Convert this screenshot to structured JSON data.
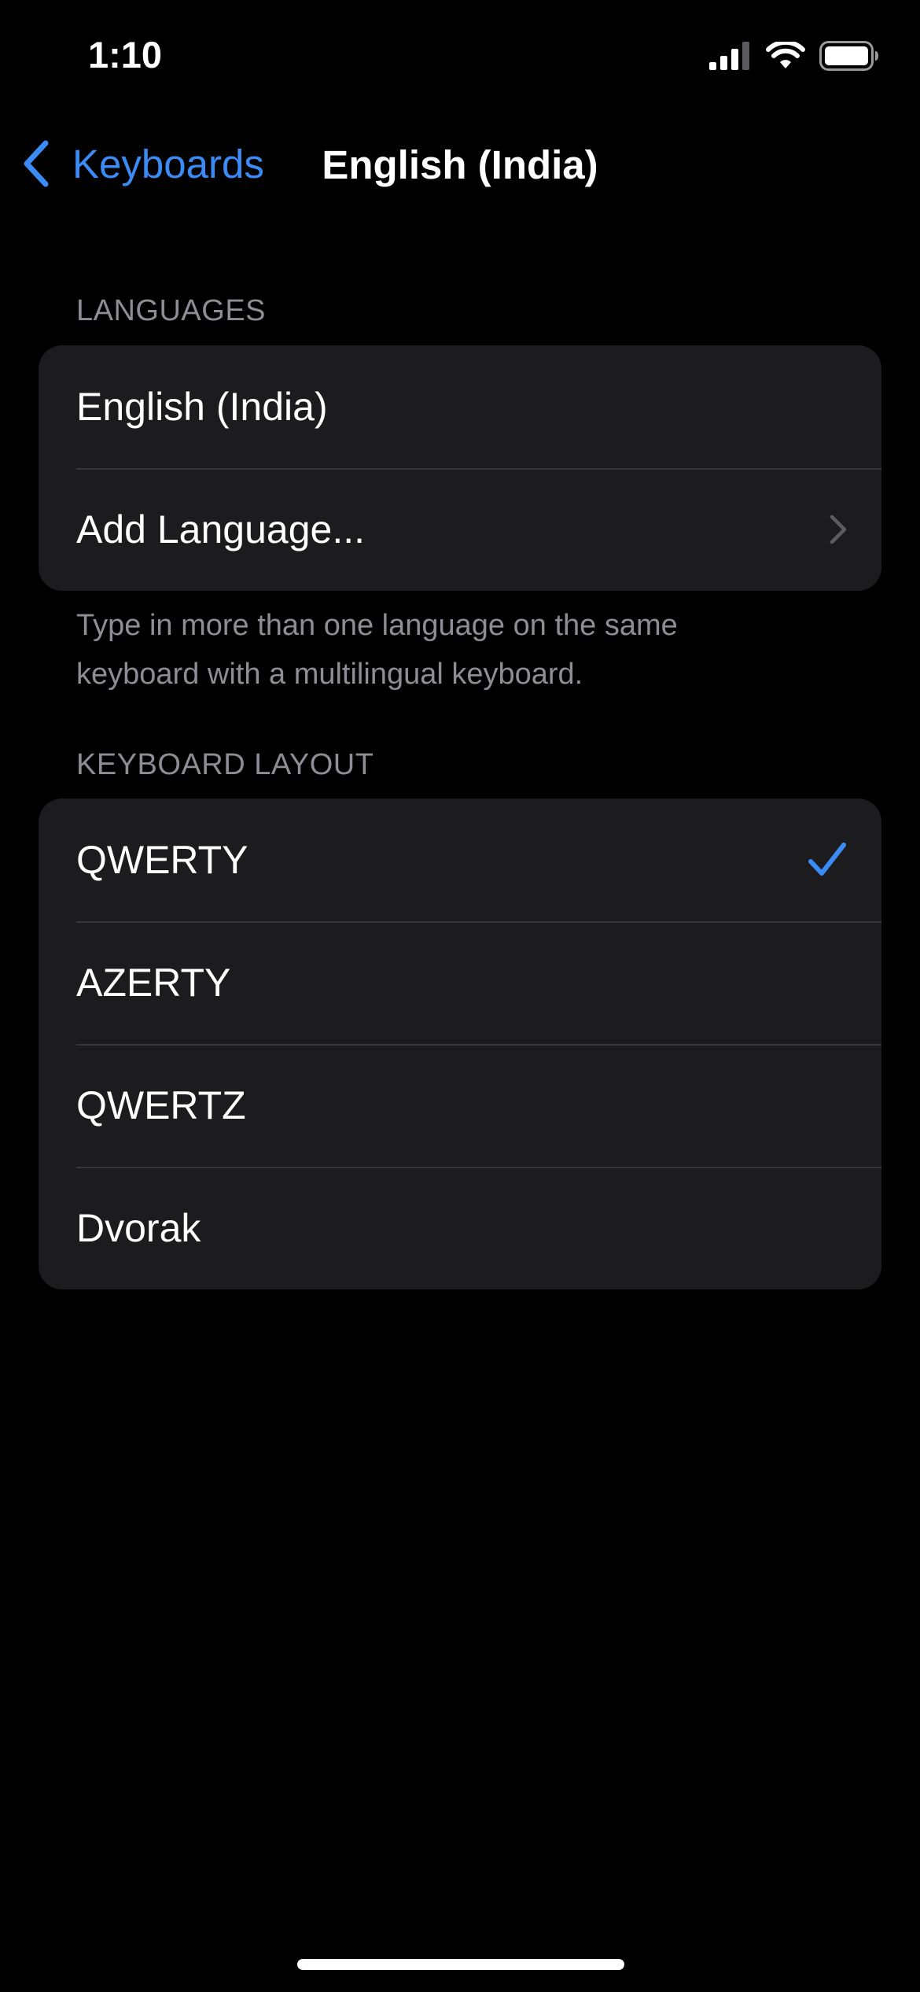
{
  "status_bar": {
    "time": "1:10"
  },
  "nav": {
    "back_label": "Keyboards",
    "title": "English (India)"
  },
  "languages_section": {
    "header": "LANGUAGES",
    "items": [
      {
        "label": "English (India)"
      },
      {
        "label": "Add Language..."
      }
    ],
    "footer": "Type in more than one language on the same keyboard with a multilingual keyboard."
  },
  "layout_section": {
    "header": "KEYBOARD LAYOUT",
    "items": [
      {
        "label": "QWERTY",
        "selected": true
      },
      {
        "label": "AZERTY",
        "selected": false
      },
      {
        "label": "QWERTZ",
        "selected": false
      },
      {
        "label": "Dvorak",
        "selected": false
      }
    ]
  },
  "colors": {
    "accent": "#3a8bf5",
    "background": "#000000",
    "group_background": "#1c1c1e",
    "secondary_text": "#8d8d93"
  },
  "icons": {
    "back": "chevron-left-icon",
    "disclosure": "chevron-right-icon",
    "selected": "checkmark-icon",
    "signal": "cellular-signal-icon",
    "wifi": "wifi-icon",
    "battery": "battery-icon"
  }
}
